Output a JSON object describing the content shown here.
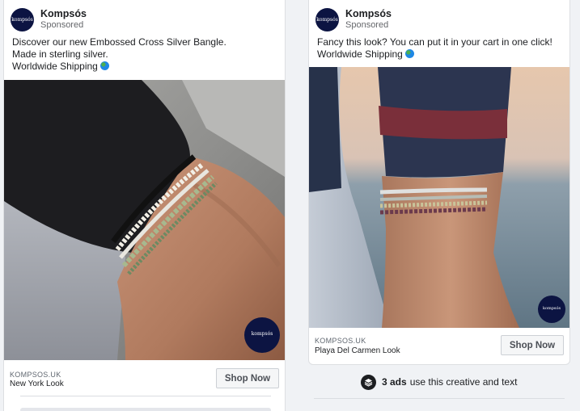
{
  "left_ad": {
    "page_name": "Kompsós",
    "sponsored": "Sponsored",
    "logo_text": "kompsós",
    "body_lines": [
      "Discover our new Embossed Cross Silver Bangle.",
      "Made in sterling silver.",
      "Worldwide Shipping"
    ],
    "watermark_text": "kompsós",
    "domain": "KOMPSOS.UK",
    "headline": "New York Look",
    "cta": "Shop Now"
  },
  "right_ad": {
    "page_name": "Kompsós",
    "sponsored": "Sponsored",
    "logo_text": "kompsós",
    "body_lines": [
      "Fancy this look? You can put it in your cart in one click!",
      "Worldwide Shipping"
    ],
    "watermark_text": "kompsós",
    "domain": "KOMPSOS.UK",
    "headline": "Playa Del Carmen Look",
    "cta": "Shop Now"
  },
  "ads_summary": {
    "count": "3 ads",
    "text": "use this creative and text",
    "icon": "stack-icon"
  },
  "colors": {
    "brand_navy": "#0c1442",
    "background": "#f0f2f5",
    "text": "#1c1e21",
    "muted": "#65676b"
  }
}
